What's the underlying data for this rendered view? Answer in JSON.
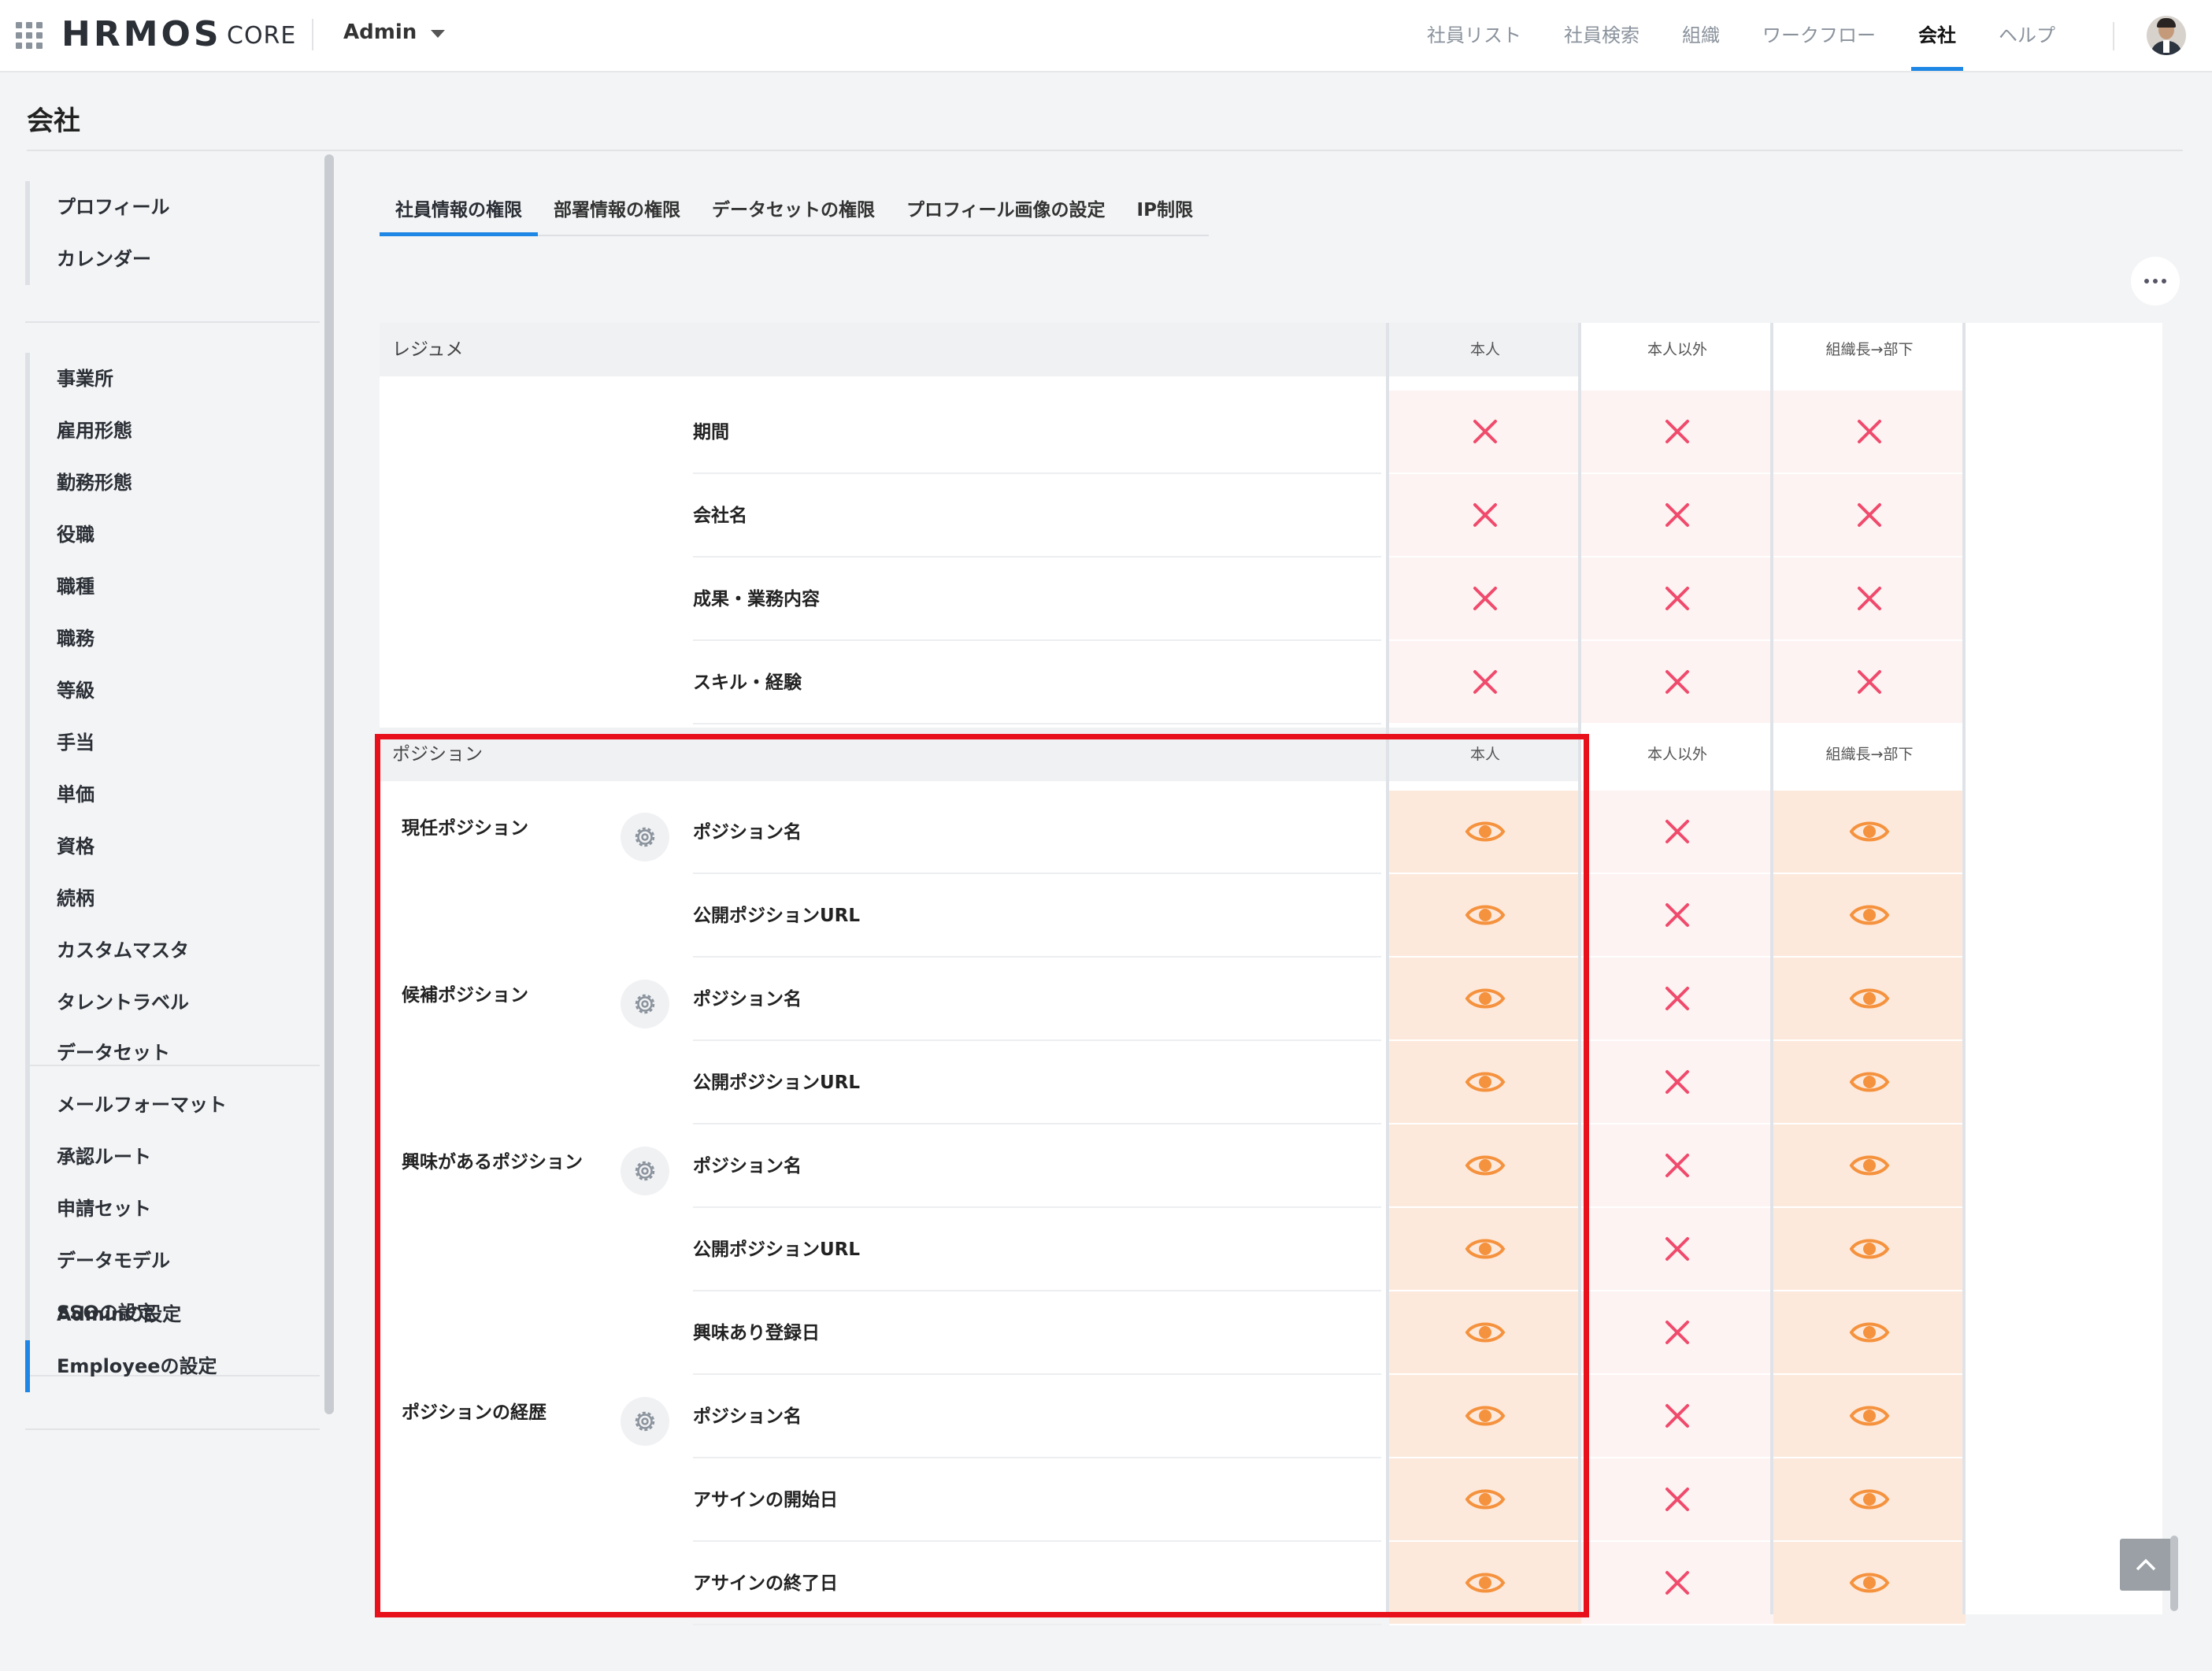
{
  "header": {
    "logo": "HRMOS",
    "logo_sub": "CORE",
    "role": "Admin",
    "nav": [
      "社員リスト",
      "社員検索",
      "組織",
      "ワークフロー",
      "会社",
      "ヘルプ"
    ],
    "active_nav": "会社"
  },
  "page": {
    "title": "会社"
  },
  "sidebar": {
    "groups": [
      [
        "プロフィール",
        "カレンダー"
      ],
      [
        "事業所",
        "雇用形態",
        "勤務形態",
        "役職",
        "職種",
        "職務",
        "等級",
        "手当",
        "単価",
        "資格",
        "続柄",
        "カスタムマスタ",
        "タレントラベル"
      ],
      [
        "データセット",
        "メールフォーマット",
        "承認ルート",
        "申請セット",
        "データモデル",
        "SSOの設定"
      ],
      [
        "Adminの設定",
        "Employeeの設定"
      ]
    ],
    "active_item": "Employeeの設定"
  },
  "tabs": {
    "items": [
      "社員情報の権限",
      "部署情報の権限",
      "データセットの権限",
      "プロフィール画像の設定",
      "IP制限"
    ],
    "active": "社員情報の権限"
  },
  "columns": [
    "本人",
    "本人以外",
    "組織長→部下"
  ],
  "sections": [
    {
      "title": "レジュメ",
      "groups": [
        {
          "label": "",
          "rows": [
            {
              "field": "期間",
              "perms": [
                "deny",
                "deny",
                "deny"
              ]
            },
            {
              "field": "会社名",
              "perms": [
                "deny",
                "deny",
                "deny"
              ]
            },
            {
              "field": "成果・業務内容",
              "perms": [
                "deny",
                "deny",
                "deny"
              ]
            },
            {
              "field": "スキル・経験",
              "perms": [
                "deny",
                "deny",
                "deny"
              ]
            }
          ]
        }
      ]
    },
    {
      "title": "ポジション",
      "groups": [
        {
          "label": "現任ポジション",
          "rows": [
            {
              "field": "ポジション名",
              "perms": [
                "view",
                "deny",
                "view"
              ]
            },
            {
              "field": "公開ポジションURL",
              "perms": [
                "view",
                "deny",
                "view"
              ]
            }
          ]
        },
        {
          "label": "候補ポジション",
          "rows": [
            {
              "field": "ポジション名",
              "perms": [
                "view",
                "deny",
                "view"
              ]
            },
            {
              "field": "公開ポジションURL",
              "perms": [
                "view",
                "deny",
                "view"
              ]
            }
          ]
        },
        {
          "label": "興味があるポジション",
          "rows": [
            {
              "field": "ポジション名",
              "perms": [
                "view",
                "deny",
                "view"
              ]
            },
            {
              "field": "公開ポジションURL",
              "perms": [
                "view",
                "deny",
                "view"
              ]
            },
            {
              "field": "興味あり登録日",
              "perms": [
                "view",
                "deny",
                "view"
              ]
            }
          ]
        },
        {
          "label": "ポジションの経歴",
          "rows": [
            {
              "field": "ポジション名",
              "perms": [
                "view",
                "deny",
                "view"
              ]
            },
            {
              "field": "アサインの開始日",
              "perms": [
                "view",
                "deny",
                "view"
              ]
            },
            {
              "field": "アサインの終了日",
              "perms": [
                "view",
                "deny",
                "view"
              ]
            }
          ]
        }
      ]
    }
  ],
  "colors": {
    "accent": "#1e87e5",
    "deny_icon": "#f04a6c",
    "view_icon": "#f5923e",
    "highlight": "#e8101b"
  }
}
